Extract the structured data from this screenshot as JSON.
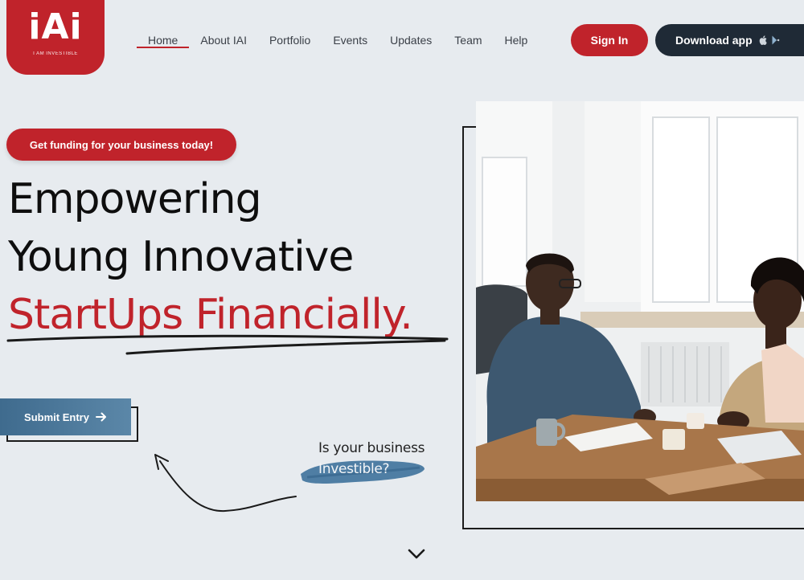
{
  "brand": {
    "logo_text": "iAi",
    "tagline": "I AM INVESTIBLE"
  },
  "nav": {
    "items": [
      "Home",
      "About IAI",
      "Portfolio",
      "Events",
      "Updates",
      "Team",
      "Help"
    ],
    "active": "Home"
  },
  "header": {
    "signin_label": "Sign In",
    "download_label": "Download app",
    "store_icons": [
      "apple-icon",
      "google-play-icon"
    ]
  },
  "hero": {
    "pill_label": "Get funding for your business today!",
    "headline_line1": "Empowering",
    "headline_line2": "Young Innovative",
    "headline_line3": "StartUps Financially.",
    "submit_label": "Submit Entry",
    "question_line1": "Is your business",
    "question_line2": "Investible?"
  },
  "colors": {
    "brand_red": "#c0232b",
    "dark_navy": "#1f2a36",
    "submit_blue": "#4a7598",
    "background": "#e7ebef"
  }
}
